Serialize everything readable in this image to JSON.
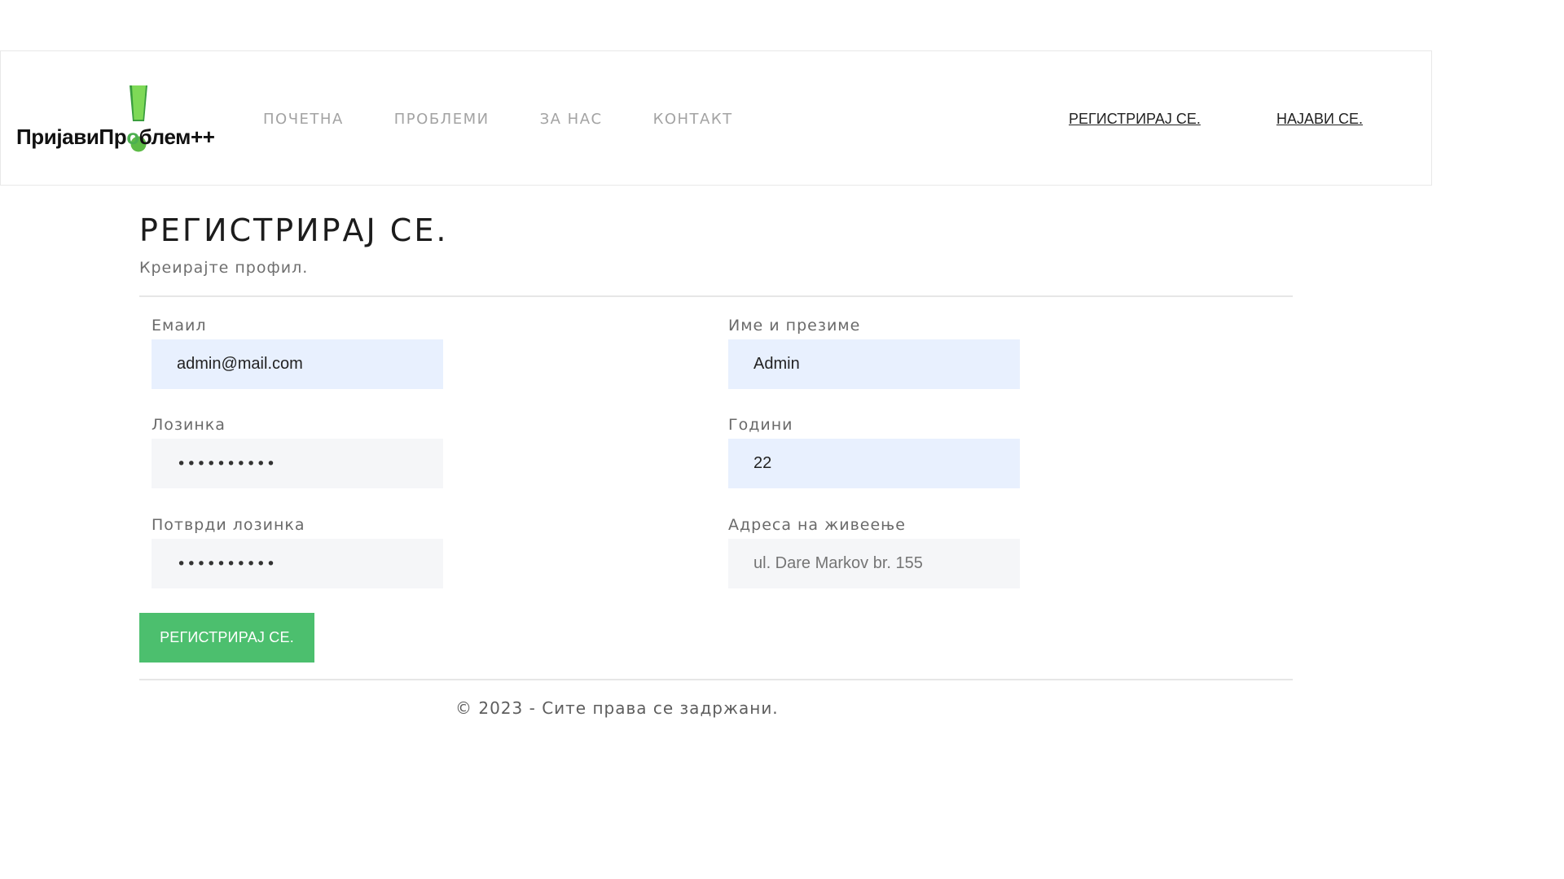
{
  "header": {
    "logo": {
      "text_part1": "ПријавиПр",
      "text_part2": "о",
      "text_part3": "блем++",
      "accent_color": "#4caf50"
    },
    "nav": [
      {
        "label": "ПОЧЕТНА"
      },
      {
        "label": "ПРОБЛЕМИ"
      },
      {
        "label": "ЗА НАС"
      },
      {
        "label": "КОНТАКТ"
      }
    ],
    "register_link": "РЕГИСТРИРАЈ СЕ.",
    "login_link": "НАЈАВИ СЕ."
  },
  "main": {
    "title": "РЕГИСТРИРАЈ СЕ.",
    "subtitle": "Креирајте профил.",
    "form": {
      "email": {
        "label": "Емаил",
        "value": "admin@mail.com"
      },
      "password": {
        "label": "Лозинка",
        "value": "••••••••••"
      },
      "confirm_password": {
        "label": "Потврди лозинка",
        "value": "••••••••••"
      },
      "full_name": {
        "label": "Име и презиме",
        "value": "Admin"
      },
      "age": {
        "label": "Години",
        "value": "22"
      },
      "address": {
        "label": "Адреса на живеење",
        "placeholder": "ul. Dare Markov br. 155"
      }
    },
    "submit_label": "РЕГИСТРИРАЈ СЕ."
  },
  "footer": {
    "copyright": "© 2023 - Сите права се задржани."
  },
  "colors": {
    "accent_green": "#4cbf6e",
    "autofill_bg": "#e8f0fe",
    "input_bg": "#f5f6f8"
  }
}
